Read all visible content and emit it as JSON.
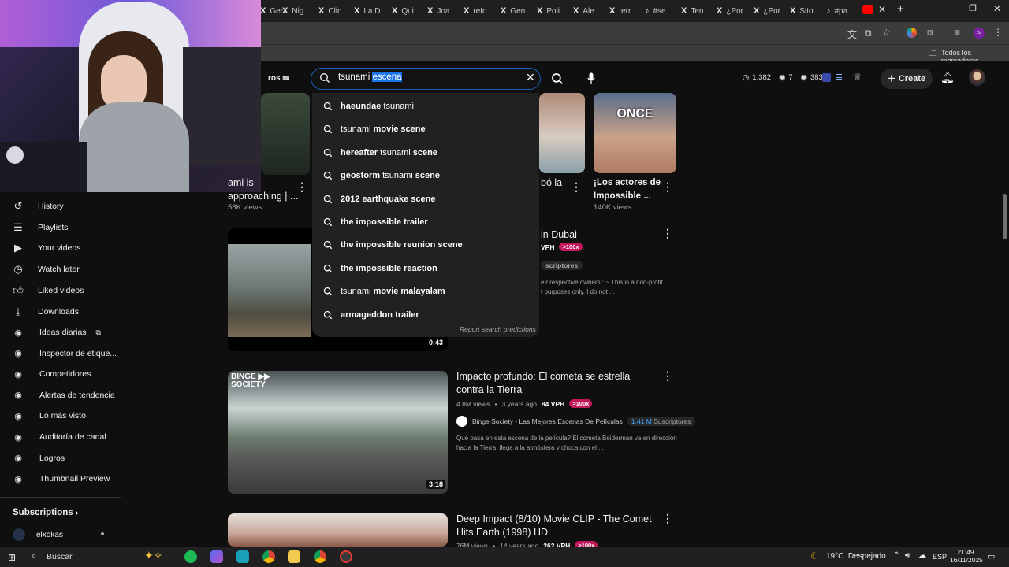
{
  "browser": {
    "tabs": [
      "Ger",
      "Nig",
      "Clin",
      "La D",
      "Qui",
      "Joa",
      "refo",
      "Gen",
      "Poli",
      "Ale",
      "terr",
      "#se",
      "Ten",
      "¿Por",
      "¿Por",
      "Sito",
      "#pa"
    ],
    "bookmarks_label": "Todos los marcadores"
  },
  "header": {
    "filters_label": "ros",
    "search_prefix": "tsunami ",
    "search_selected": "escena",
    "stats": {
      "views": "1,382",
      "eye_count": "7",
      "eye_count2": "383"
    },
    "create_label": "Create"
  },
  "suggestions": [
    {
      "bold": "haeundae",
      "rest": " tsunami"
    },
    {
      "bold": "",
      "rest": "tsunami",
      "bold2": " movie scene"
    },
    {
      "bold": "hereafter",
      "rest": " tsunami",
      "bold2": " scene"
    },
    {
      "bold": "geostorm",
      "rest": " tsunami",
      "bold2": " scene"
    },
    {
      "bold": "2012 earthquake scene",
      "rest": ""
    },
    {
      "bold": "the impossible trailer",
      "rest": ""
    },
    {
      "bold": "the impossible reunion scene",
      "rest": ""
    },
    {
      "bold": "the impossible reaction",
      "rest": ""
    },
    {
      "bold": "",
      "rest": "tsunami",
      "bold2": " movie malayalam"
    },
    {
      "bold": "armageddon trailer",
      "rest": ""
    }
  ],
  "report_label": "Report search predictions",
  "sidebar": {
    "items": [
      "History",
      "Playlists",
      "Your videos",
      "Watch later",
      "Liked videos",
      "Downloads"
    ],
    "ext_items": [
      "Ideas diarias",
      "Inspector de etique...",
      "Competidores",
      "Alertas de tendencia",
      "Lo más visto",
      "Auditoría de canal",
      "Logros",
      "Thumbnail Preview"
    ],
    "subscriptions_label": "Subscriptions",
    "sub_channel": "elxokas"
  },
  "top_row": {
    "card1": {
      "title1": "ami is",
      "title2": "approaching | ...",
      "views": "56K views"
    },
    "card2": {
      "title": "bó la"
    },
    "card3": {
      "thumb_text": "ONCE",
      "title1": "¡Los actores de",
      "title2": "Impossible ...",
      "views": "140K views"
    }
  },
  "video1": {
    "title_tail": "in Dubai",
    "vph": "VPH",
    "ratio": ">100x",
    "subs_tail": "scriptores",
    "desc1": "eir respective owners : ~ This is a non-profit",
    "desc2": "t purposes only. I do not ...",
    "duration": "0:43"
  },
  "video2": {
    "thumb_text": "BINGE ▶▶ SOCIETY",
    "title1": "Impacto profundo: El cometa se estrella",
    "title2": "contra la Tierra",
    "views": "4.8M views",
    "age": "3 years ago",
    "vph": "84 VPH",
    "ratio": ">100x",
    "channel": "Binge Society - Las Mejores Escenas De Películas",
    "subs": "1,41 M",
    "subs_label": "Suscriptores",
    "desc1": "Qué pasa en esta escena de la película? El cometa Beiderman va en dirección",
    "desc2": "hacia la Tierra, llega a la atmósfera y choca con el ...",
    "duration": "3:18"
  },
  "video3": {
    "title1": "Deep Impact (8/10) Movie CLIP - The Comet",
    "title2": "Hits Earth (1998) HD",
    "views": "76M views",
    "age": "14 years ago",
    "vph": "262 VPH",
    "ratio": ">100x"
  },
  "taskbar": {
    "search_label": "Buscar",
    "weather": "19°C  Despejado",
    "lang": "ESP",
    "time": "21:49",
    "date": "16/11/2025"
  },
  "colors": {
    "accent": "#1a73e8",
    "pill": "#c2185b",
    "bg": "#0f0f0f",
    "dropdown": "#212121"
  }
}
